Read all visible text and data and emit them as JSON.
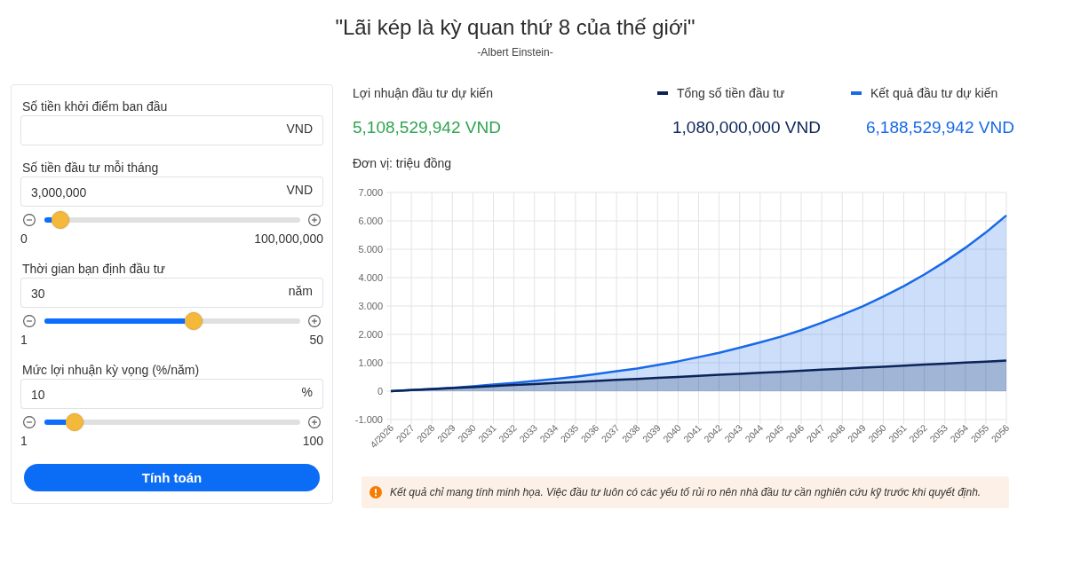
{
  "header": {
    "quote": "\"Lãi kép là kỳ quan thứ 8 của thế giới\"",
    "author": "-Albert Einstein-"
  },
  "calculator": {
    "fields": [
      {
        "label": "Số tiền khởi điểm ban đầu",
        "unit": "VND"
      },
      {
        "label": "Số tiền đầu tư mỗi tháng",
        "value": "3,000,000",
        "unit": "VND",
        "slider": {
          "level": 0.03,
          "min": "0",
          "max": "100,000,000"
        }
      },
      {
        "label": "Thời gian bạn định đầu tư",
        "value": "30",
        "unit": "năm",
        "slider": {
          "level": 0.59,
          "min": "1",
          "max": "50"
        }
      },
      {
        "label": "Mức lợi nhuận kỳ vọng (%/năm)",
        "value": "10",
        "unit": "%",
        "slider": {
          "level": 0.09,
          "min": "1",
          "max": "100"
        }
      }
    ],
    "button": "Tính toán"
  },
  "results": {
    "profit": {
      "label": "Lợi nhuận đầu tư dự kiến",
      "value": "5,108,529,942 VND"
    },
    "totals": [
      {
        "value": "1,080,000,000 VND"
      },
      {
        "value": "6,188,529,942 VND"
      }
    ],
    "chart_data": {
      "type": "area",
      "ylabel": "Đơn vị: triệu đồng",
      "ylim": [
        -1,
        7
      ],
      "grid": true,
      "yticks": [
        {
          "value": -1,
          "label": "-1.000"
        },
        {
          "value": 0,
          "label": "0"
        },
        {
          "value": 1,
          "label": "1.000"
        },
        {
          "value": 2,
          "label": "2.000"
        },
        {
          "value": 3,
          "label": "3.000"
        },
        {
          "value": 4,
          "label": "4.000"
        },
        {
          "value": 5,
          "label": "5.000"
        },
        {
          "value": 6,
          "label": "6.000"
        },
        {
          "value": 7,
          "label": "7.000"
        }
      ],
      "categories": [
        "4/2026",
        "2027",
        "2028",
        "2029",
        "2030",
        "2031",
        "2032",
        "2033",
        "2034",
        "2035",
        "2036",
        "2037",
        "2038",
        "2039",
        "2040",
        "2041",
        "2042",
        "2043",
        "2044",
        "2045",
        "2046",
        "2047",
        "2048",
        "2049",
        "2050",
        "2051",
        "2052",
        "2053",
        "2054",
        "2055",
        "2056"
      ],
      "series": [
        {
          "name": "Tổng số tiền đầu tư",
          "color": "#0b2458",
          "values": [
            0,
            0.04,
            0.07,
            0.11,
            0.14,
            0.18,
            0.22,
            0.25,
            0.29,
            0.32,
            0.36,
            0.4,
            0.43,
            0.47,
            0.5,
            0.54,
            0.58,
            0.61,
            0.65,
            0.68,
            0.72,
            0.76,
            0.79,
            0.83,
            0.86,
            0.9,
            0.94,
            0.97,
            1.01,
            1.04,
            1.08
          ]
        },
        {
          "name": "Kết quả đầu tư dự kiến",
          "color": "#1769e8",
          "values": [
            0,
            0.04,
            0.08,
            0.12,
            0.17,
            0.23,
            0.29,
            0.36,
            0.43,
            0.51,
            0.6,
            0.7,
            0.8,
            0.92,
            1.05,
            1.2,
            1.35,
            1.53,
            1.72,
            1.92,
            2.15,
            2.41,
            2.69,
            2.99,
            3.33,
            3.7,
            4.11,
            4.56,
            5.05,
            5.59,
            6.19
          ]
        }
      ]
    },
    "notice": "Kết quả chỉ mang tính minh họa. Việc đầu tư luôn có các yếu tố rủi ro nên nhà đầu tư cần nghiên cứu kỹ trước khi quyết định."
  }
}
